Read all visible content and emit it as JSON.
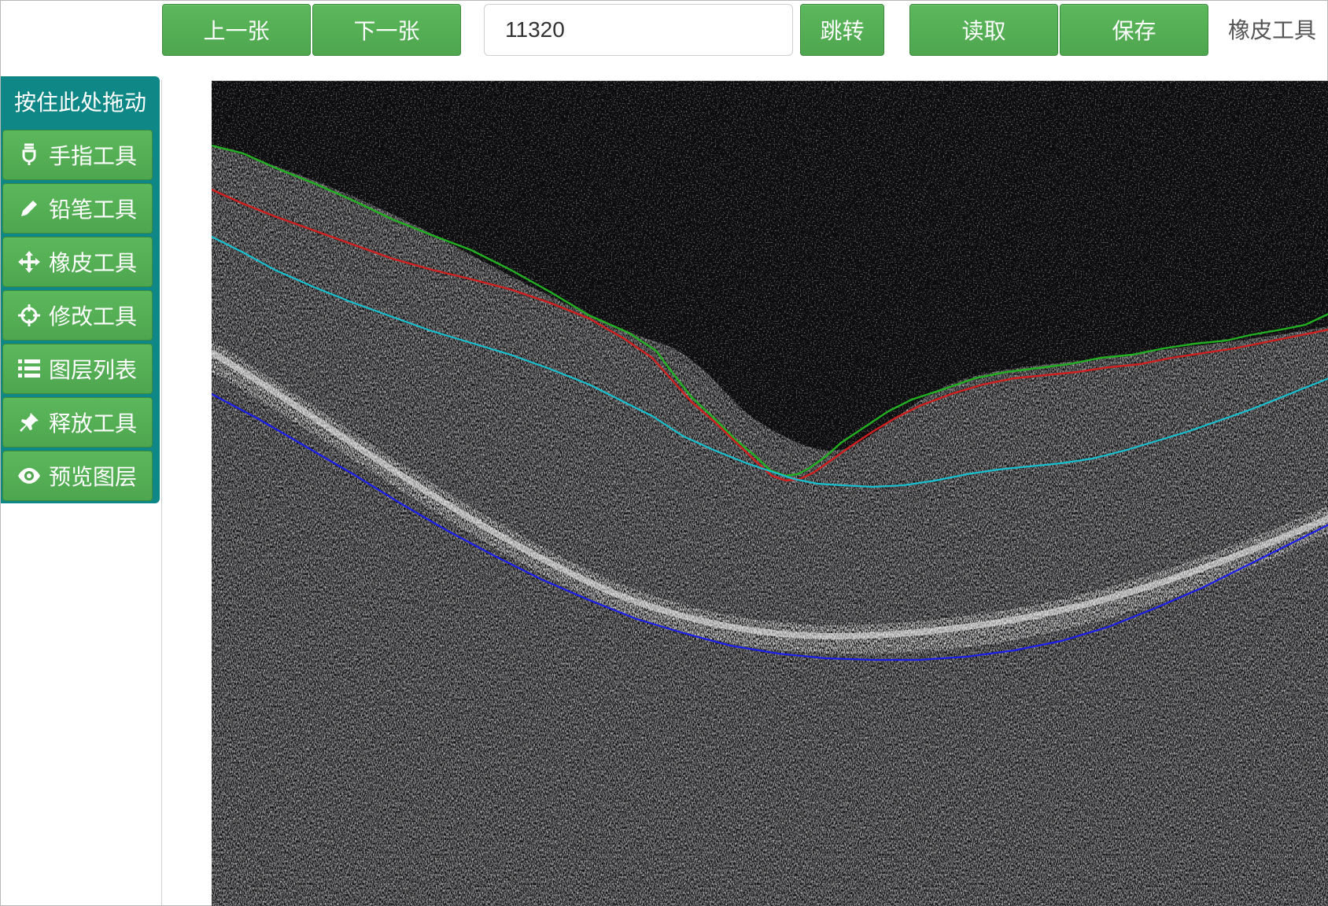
{
  "toolbar": {
    "prev_label": "上一张",
    "next_label": "下一张",
    "goto_value": "11320",
    "goto_label": "跳转",
    "read_label": "读取",
    "save_label": "保存",
    "current_tool": "橡皮工具"
  },
  "tool_panel": {
    "drag_label": "按住此处拖动",
    "items": [
      {
        "label": "手指工具",
        "icon": "finger-icon"
      },
      {
        "label": "铅笔工具",
        "icon": "pencil-icon"
      },
      {
        "label": "橡皮工具",
        "icon": "move-icon"
      },
      {
        "label": "修改工具",
        "icon": "crosshair-icon"
      },
      {
        "label": "图层列表",
        "icon": "list-icon"
      },
      {
        "label": "释放工具",
        "icon": "pin-icon"
      },
      {
        "label": "预览图层",
        "icon": "eye-icon"
      }
    ]
  },
  "layers": [
    {
      "name": "green",
      "color": "#22b022"
    },
    {
      "name": "red",
      "color": "#d01f1f"
    },
    {
      "name": "cyan",
      "color": "#18c0cf"
    },
    {
      "name": "blue",
      "color": "#1a1ee8"
    }
  ],
  "colors": {
    "button_green": "#5cb85c",
    "panel_teal": "#0f8786",
    "canvas_bg": "#0b0a0c"
  }
}
